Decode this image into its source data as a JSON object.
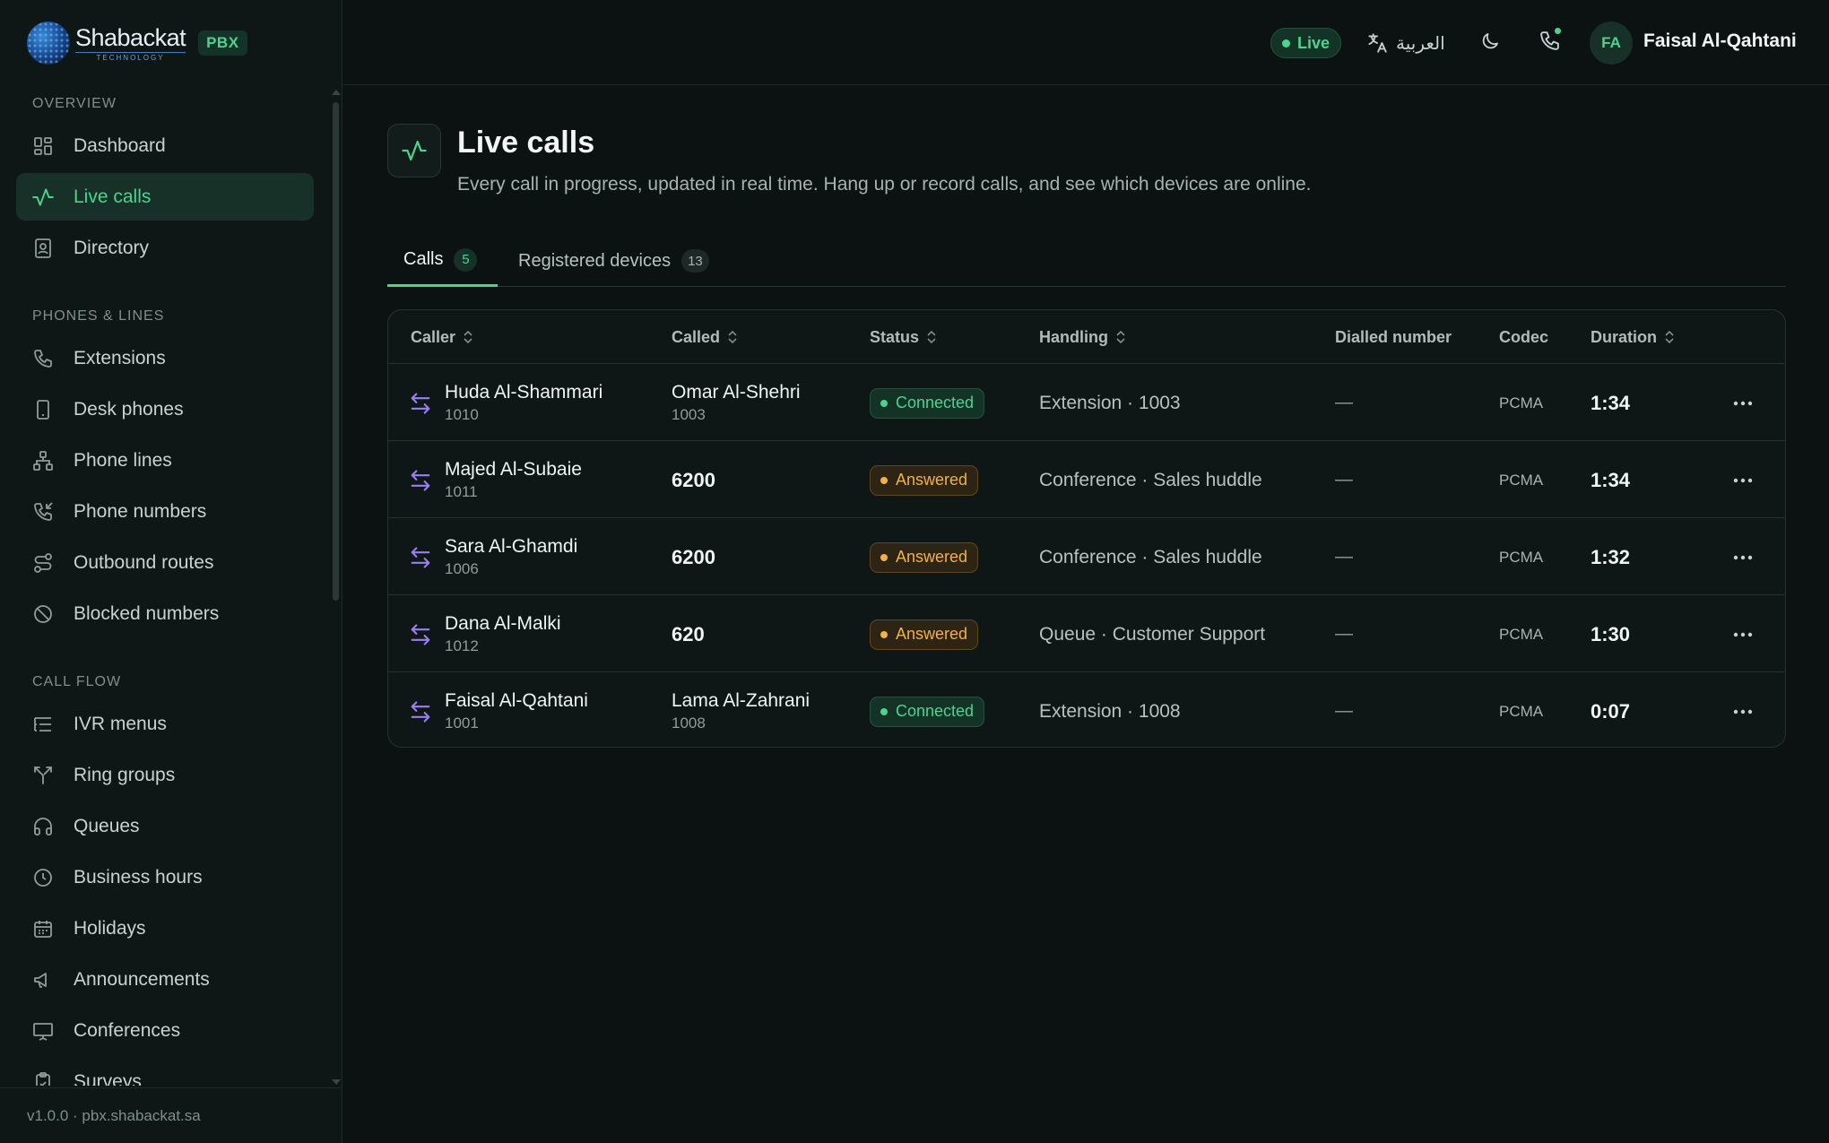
{
  "brand": {
    "name": "Shabackat",
    "sub": "TECHNOLOGY",
    "badge": "PBX"
  },
  "sidebar": {
    "sections": [
      {
        "title": "OVERVIEW",
        "items": [
          {
            "label": "Dashboard",
            "icon": "grid-icon",
            "active": false
          },
          {
            "label": "Live calls",
            "icon": "activity-icon",
            "active": true
          },
          {
            "label": "Directory",
            "icon": "contact-book-icon",
            "active": false
          }
        ]
      },
      {
        "title": "PHONES & LINES",
        "items": [
          {
            "label": "Extensions",
            "icon": "phone-icon",
            "active": false
          },
          {
            "label": "Desk phones",
            "icon": "device-icon",
            "active": false
          },
          {
            "label": "Phone lines",
            "icon": "network-icon",
            "active": false
          },
          {
            "label": "Phone numbers",
            "icon": "phone-incoming-icon",
            "active": false
          },
          {
            "label": "Outbound routes",
            "icon": "route-icon",
            "active": false
          },
          {
            "label": "Blocked numbers",
            "icon": "ban-icon",
            "active": false
          }
        ]
      },
      {
        "title": "CALL FLOW",
        "items": [
          {
            "label": "IVR menus",
            "icon": "list-tree-icon",
            "active": false
          },
          {
            "label": "Ring groups",
            "icon": "split-icon",
            "active": false
          },
          {
            "label": "Queues",
            "icon": "headphones-icon",
            "active": false
          },
          {
            "label": "Business hours",
            "icon": "clock-icon",
            "active": false
          },
          {
            "label": "Holidays",
            "icon": "calendar-icon",
            "active": false
          },
          {
            "label": "Announcements",
            "icon": "megaphone-icon",
            "active": false
          },
          {
            "label": "Conferences",
            "icon": "presentation-icon",
            "active": false
          },
          {
            "label": "Surveys",
            "icon": "clipboard-check-icon",
            "active": false
          }
        ]
      }
    ],
    "footer": "v1.0.0 · pbx.shabackat.sa"
  },
  "header": {
    "live_label": "Live",
    "language_label": "العربية",
    "user_initials": "FA",
    "user_name": "Faisal Al-Qahtani"
  },
  "page": {
    "title": "Live calls",
    "description": "Every call in progress, updated in real time. Hang up or record calls, and see which devices are online."
  },
  "tabs": [
    {
      "label": "Calls",
      "count": "5",
      "active": true
    },
    {
      "label": "Registered devices",
      "count": "13",
      "active": false
    }
  ],
  "table": {
    "columns": [
      "Caller",
      "Called",
      "Status",
      "Handling",
      "Dialled number",
      "Codec",
      "Duration"
    ],
    "rows": [
      {
        "caller_name": "Huda Al-Shammari",
        "caller_ext": "1010",
        "called_name": "Omar Al-Shehri",
        "called_ext": "1003",
        "status": "Connected",
        "handling": "Extension · 1003",
        "dialled": "—",
        "codec": "PCMA",
        "duration": "1:34"
      },
      {
        "caller_name": "Majed Al-Subaie",
        "caller_ext": "1011",
        "called_name": "6200",
        "called_ext": "",
        "status": "Answered",
        "handling": "Conference · Sales huddle",
        "dialled": "—",
        "codec": "PCMA",
        "duration": "1:34"
      },
      {
        "caller_name": "Sara Al-Ghamdi",
        "caller_ext": "1006",
        "called_name": "6200",
        "called_ext": "",
        "status": "Answered",
        "handling": "Conference · Sales huddle",
        "dialled": "—",
        "codec": "PCMA",
        "duration": "1:32"
      },
      {
        "caller_name": "Dana Al-Malki",
        "caller_ext": "1012",
        "called_name": "620",
        "called_ext": "",
        "status": "Answered",
        "handling": "Queue · Customer Support",
        "dialled": "—",
        "codec": "PCMA",
        "duration": "1:30"
      },
      {
        "caller_name": "Faisal Al-Qahtani",
        "caller_ext": "1001",
        "called_name": "Lama Al-Zahrani",
        "called_ext": "1008",
        "status": "Connected",
        "handling": "Extension · 1008",
        "dialled": "—",
        "codec": "PCMA",
        "duration": "0:07"
      }
    ]
  },
  "colors": {
    "accent": "#4fd28e",
    "answered": "#f0b14a",
    "direction": "#9b7ff0",
    "background": "#0c1211"
  }
}
